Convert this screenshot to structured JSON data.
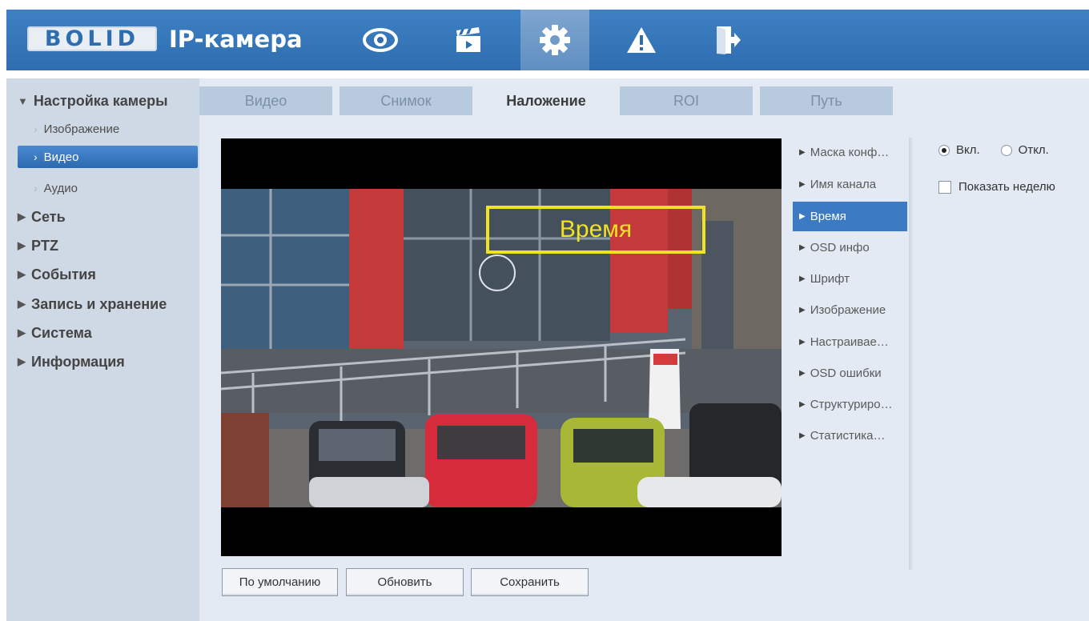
{
  "header": {
    "logo": "BOLID",
    "title": "IP-камера",
    "nav_icons": [
      "eye-icon",
      "clapperboard-icon",
      "gear-icon",
      "warning-icon",
      "logout-icon"
    ],
    "active_nav": "gear-icon",
    "colors": {
      "header": "#2e6db0",
      "sidebar": "#cfd9e5",
      "content": "#e3eaf3",
      "accent": "#3c7bc4",
      "osd": "#f0e224"
    }
  },
  "sidebar": {
    "camera_settings": "Настройка камеры",
    "sub_image": "Изображение",
    "sub_video": "Видео",
    "sub_audio": "Аудио",
    "network": "Сеть",
    "ptz": "PTZ",
    "events": "События",
    "storage": "Запись и хранение",
    "system": "Система",
    "info": "Информация"
  },
  "tabs": {
    "video": "Видео",
    "snapshot": "Снимок",
    "overlay": "Наложение",
    "roi": "ROI",
    "path": "Путь",
    "active": "Наложение"
  },
  "preview": {
    "osd_label": "Время"
  },
  "overlay_menu": {
    "privacy_mask": "Маска конф…",
    "channel_name": "Имя канала",
    "time": "Время",
    "osd_info": "OSD инфо",
    "font": "Шрифт",
    "image": "Изображение",
    "custom": "Настраивае…",
    "osd_errors": "OSD ошибки",
    "structured": "Структуриро…",
    "statistics": "Статистика…",
    "selected": "Время"
  },
  "options": {
    "on_label": "Вкл.",
    "off_label": "Откл.",
    "on_selected": true,
    "show_week_label": "Показать неделю",
    "show_week_checked": false
  },
  "buttons": {
    "default": "По умолчанию",
    "refresh": "Обновить",
    "save": "Сохранить"
  }
}
